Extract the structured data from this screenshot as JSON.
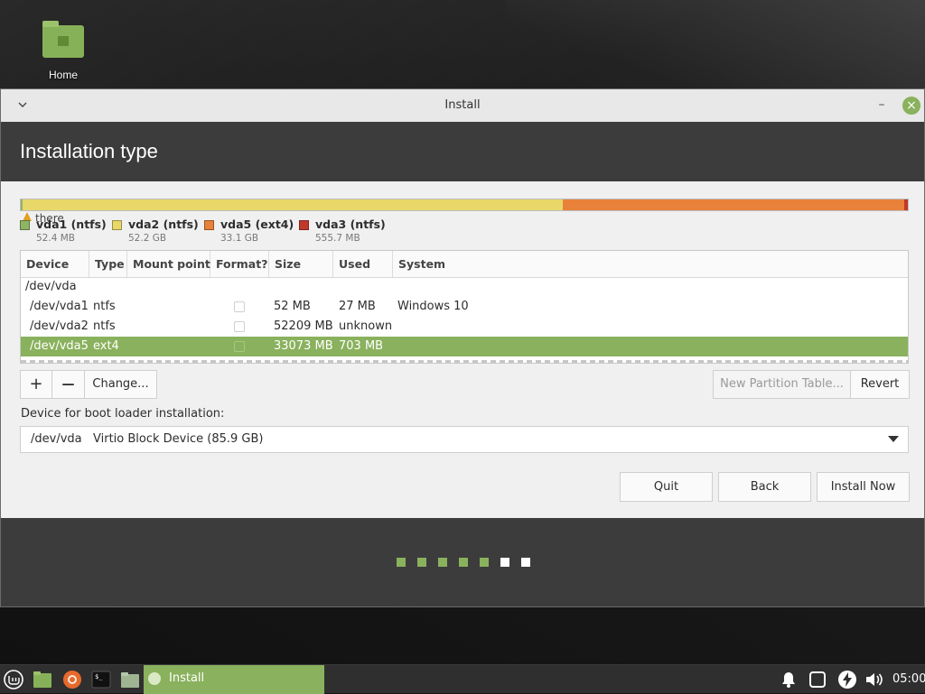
{
  "desktop": {
    "icons": [
      {
        "label": "Home",
        "icon": "home-folder-icon"
      }
    ]
  },
  "window": {
    "title": "Install",
    "header_title": "Installation type",
    "accent": "#8ab15d"
  },
  "partition_bar": {
    "overlay_text": "there",
    "segments": [
      {
        "name": "vda1 (ntfs)",
        "size": "52.4 MB",
        "color": "#8fb464",
        "fraction": 0.001
      },
      {
        "name": "vda2 (ntfs)",
        "size": "52.2 GB",
        "color": "#e8d86a",
        "fraction": 0.61
      },
      {
        "name": "vda5 (ext4)",
        "size": "33.1 GB",
        "color": "#e8823a",
        "fraction": 0.385
      },
      {
        "name": "vda3 (ntfs)",
        "size": "555.7 MB",
        "color": "#c0392b",
        "fraction": 0.004
      }
    ]
  },
  "table": {
    "columns": [
      "Device",
      "Type",
      "Mount point",
      "Format?",
      "Size",
      "Used",
      "System"
    ],
    "rows": [
      {
        "device": "/dev/vda",
        "type": "",
        "mount": "",
        "format": false,
        "size": "",
        "used": "",
        "system": "",
        "is_disk": true,
        "selected": false
      },
      {
        "device": "/dev/vda1",
        "type": "ntfs",
        "mount": "",
        "format": false,
        "size": "52 MB",
        "used": "27 MB",
        "system": "Windows 10",
        "is_disk": false,
        "selected": false
      },
      {
        "device": "/dev/vda2",
        "type": "ntfs",
        "mount": "",
        "format": false,
        "size": "52209 MB",
        "used": "unknown",
        "system": "",
        "is_disk": false,
        "selected": false
      },
      {
        "device": "/dev/vda5",
        "type": "ext4",
        "mount": "",
        "format": false,
        "size": "33073 MB",
        "used": "703 MB",
        "system": "",
        "is_disk": false,
        "selected": true
      }
    ]
  },
  "toolbar": {
    "add_label": "+",
    "remove_label": "—",
    "change_label": "Change...",
    "new_table_label": "New Partition Table...",
    "revert_label": "Revert"
  },
  "bootloader": {
    "label": "Device for boot loader installation:",
    "selected": "/dev/vda   Virtio Block Device (85.9 GB)"
  },
  "actions": {
    "quit": "Quit",
    "back": "Back",
    "install": "Install Now"
  },
  "progress": {
    "total_steps": 7,
    "steps": [
      {
        "state": "done",
        "color": "#8ab15d"
      },
      {
        "state": "done",
        "color": "#8ab15d"
      },
      {
        "state": "done",
        "color": "#8ab15d"
      },
      {
        "state": "done",
        "color": "#8ab15d"
      },
      {
        "state": "done",
        "color": "#8ab15d"
      },
      {
        "state": "pending",
        "color": "#ffffff"
      },
      {
        "state": "pending",
        "color": "#ffffff"
      }
    ]
  },
  "taskbar": {
    "launchers": [
      "mint-menu-icon",
      "files-icon",
      "firefox-icon",
      "terminal-icon",
      "folder-icon"
    ],
    "active_task": "Install",
    "tray": [
      "notifications-icon",
      "tablet-icon",
      "power-icon",
      "volume-icon"
    ],
    "clock": "05:00"
  }
}
